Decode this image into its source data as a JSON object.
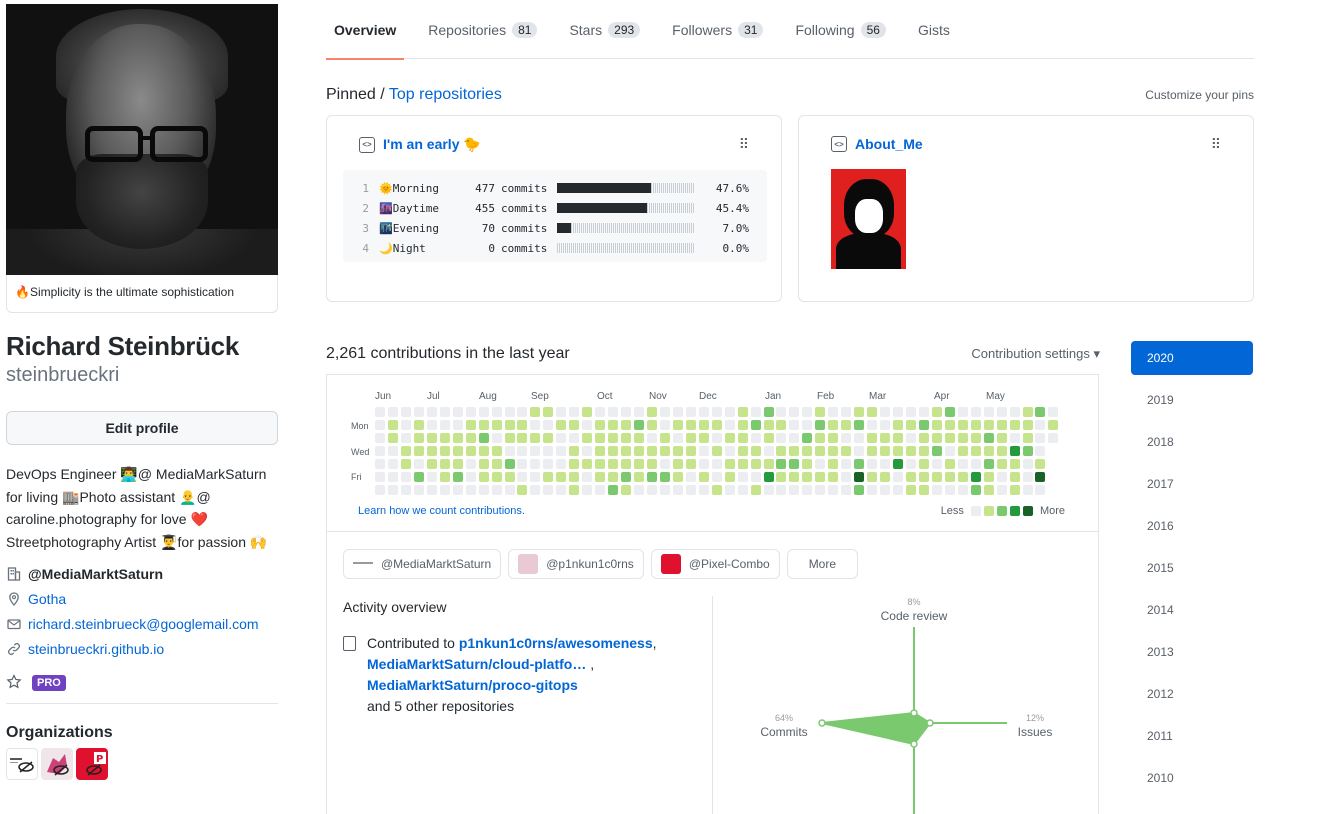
{
  "profile": {
    "status": "🔥Simplicity is the ultimate sophistication",
    "name": "Richard Steinbrück",
    "login": "steinbrueckri",
    "edit_label": "Edit profile",
    "bio": "DevOps Engineer 👨‍💻@ MediaMarkSaturn for living 🏬Photo assistant 👨‍🦲@ caroline.photography for love ❤️ Streetphotography Artist 👨‍🎓for passion 🙌",
    "company": "@MediaMarktSaturn",
    "location": "Gotha",
    "email": "richard.steinbrueck@googlemail.com",
    "website": "steinbrueckri.github.io",
    "pro_badge": "PRO",
    "orgs_title": "Organizations"
  },
  "tabs": [
    {
      "label": "Overview",
      "count": ""
    },
    {
      "label": "Repositories",
      "count": "81"
    },
    {
      "label": "Stars",
      "count": "293"
    },
    {
      "label": "Followers",
      "count": "31"
    },
    {
      "label": "Following",
      "count": "56"
    },
    {
      "label": "Gists",
      "count": ""
    }
  ],
  "pinned": {
    "prefix": "Pinned / ",
    "link": "Top repositories",
    "customize": "Customize your pins",
    "card1": {
      "title": "I'm an early 🐤",
      "rows": [
        {
          "ln": "1",
          "label": "🌞Morning",
          "num": "477",
          "unit": "commits",
          "fill": 0.476,
          "pct": "47.6%"
        },
        {
          "ln": "2",
          "label": "🌆Daytime",
          "num": "455",
          "unit": "commits",
          "fill": 0.454,
          "pct": "45.4%"
        },
        {
          "ln": "3",
          "label": "🌃Evening",
          "num": "70",
          "unit": "commits",
          "fill": 0.07,
          "pct": "7.0%"
        },
        {
          "ln": "4",
          "label": "🌙Night",
          "num": "0",
          "unit": "commits",
          "fill": 0.0,
          "pct": "0.0%"
        }
      ]
    },
    "card2": {
      "title": "About_Me"
    }
  },
  "contributions": {
    "heading": "2,261 contributions in the last year",
    "settings": "Contribution settings ▾",
    "months": [
      "Jun",
      "Jul",
      "Aug",
      "Sep",
      "Oct",
      "Nov",
      "Dec",
      "Jan",
      "Feb",
      "Mar",
      "Apr",
      "May"
    ],
    "days": [
      "Mon",
      "Wed",
      "Fri"
    ],
    "learn": "Learn how we count contributions.",
    "less": "Less",
    "more": "More",
    "colors": [
      "#ebedf0",
      "#c6e48b",
      "#7bc96f",
      "#239a3b",
      "#196127"
    ]
  },
  "activity": {
    "orgs": [
      "@MediaMarktSaturn",
      "@p1nkun1c0rns",
      "@Pixel-Combo"
    ],
    "more_label": "More",
    "title": "Activity overview",
    "contributed_prefix": "Contributed to ",
    "repo1": "p1nkun1c0rns/awesomeness",
    "repo2": "MediaMarktSaturn/cloud-platfo…",
    "repo3": "MediaMarktSaturn/proco-gitops",
    "others": "and 5 other repositories",
    "radar": {
      "code_review": {
        "label": "Code review",
        "pct": "8%"
      },
      "issues": {
        "label": "Issues",
        "pct": "12%"
      },
      "commits": {
        "label": "Commits",
        "pct": "64%"
      }
    }
  },
  "years": [
    "2020",
    "2019",
    "2018",
    "2017",
    "2016",
    "2015",
    "2014",
    "2013",
    "2012",
    "2011",
    "2010"
  ]
}
